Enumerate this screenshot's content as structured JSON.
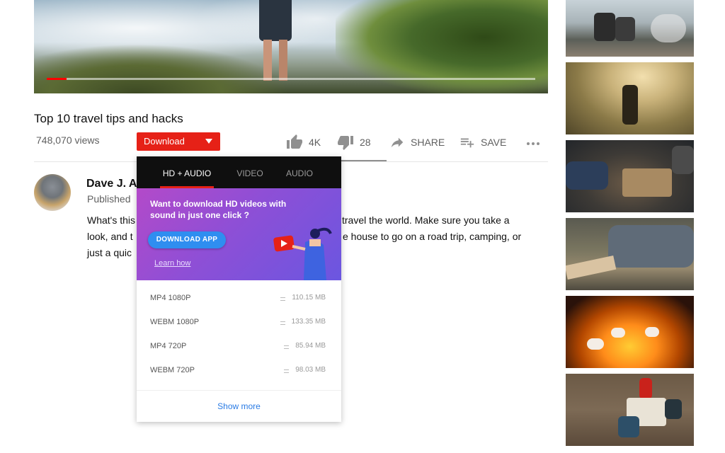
{
  "player": {
    "progress_fraction": 0.04
  },
  "video": {
    "title": "Top 10 travel tips and hacks",
    "views": "748,070 views"
  },
  "download_button": {
    "label": "Download"
  },
  "actions": {
    "like_count": "4K",
    "dislike_count": "28",
    "share_label": "SHARE",
    "save_label": "SAVE"
  },
  "channel": {
    "name": "Dave J. A",
    "published": "Published"
  },
  "description": {
    "line1_left": "What's this",
    "line1_right": "travel the world. Make sure you take a",
    "line2_left": "look, and t",
    "line2_right": "e house to go on a road trip, camping, or",
    "line3_left": "just a quic"
  },
  "dropdown": {
    "tabs": [
      {
        "label": "HD + AUDIO",
        "active": true
      },
      {
        "label": "VIDEO",
        "active": false
      },
      {
        "label": "AUDIO",
        "active": false
      }
    ],
    "promo": {
      "headline": "Want to download HD videos with sound in just one click ?",
      "app_button": "DOWNLOAD APP",
      "learn_link": "Learn how"
    },
    "formats": [
      {
        "name": "MP4 1080P",
        "size": "110.15 MB"
      },
      {
        "name": "WEBM 1080P",
        "size": "133.35 MB"
      },
      {
        "name": "MP4 720P",
        "size": "85.94 MB"
      },
      {
        "name": "WEBM 720P",
        "size": "98.03 MB"
      }
    ],
    "show_more": "Show more"
  },
  "icons": [
    "thumbs-up-icon",
    "thumbs-down-icon",
    "share-icon",
    "playlist-add-icon",
    "more-horizontal-icon",
    "caret-down-icon",
    "equals-icon"
  ],
  "colors": {
    "brand_red": "#e62117",
    "promo_gradient_start": "#b34ac9",
    "promo_gradient_end": "#6b56e0",
    "link_blue": "#2a7be4"
  }
}
